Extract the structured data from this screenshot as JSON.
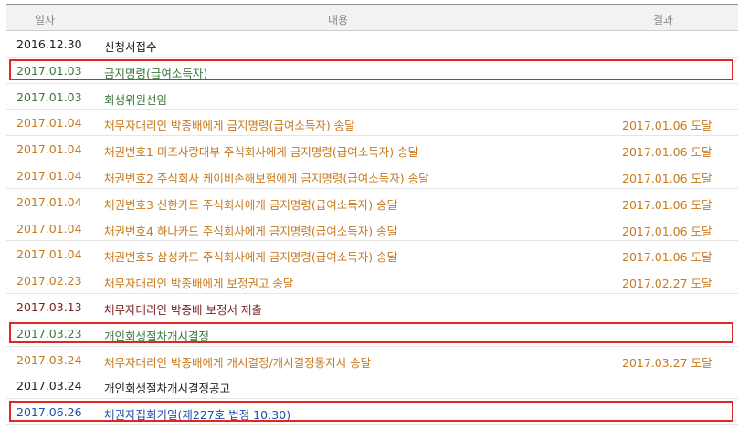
{
  "headers": {
    "date": "일자",
    "content": "내용",
    "result": "결과"
  },
  "colors": {
    "black": "#222222",
    "green": "#3d7a3d",
    "orange": "#c87a1e",
    "maroon": "#7a1f1f",
    "blue": "#1f4fa8",
    "highlight": "#e0271f"
  },
  "rows": [
    {
      "date": "2016.12.30",
      "content": "신청서접수",
      "result": "",
      "color": "black",
      "highlighted": false
    },
    {
      "date": "2017.01.03",
      "content": "금지명령(급여소득자)",
      "result": "",
      "color": "green",
      "highlighted": true
    },
    {
      "date": "2017.01.03",
      "content": "회생위원선임",
      "result": "",
      "color": "green",
      "highlighted": false
    },
    {
      "date": "2017.01.04",
      "content": "채무자대리인 박종배에게 금지명령(급여소득자) 송달",
      "result": "2017.01.06 도달",
      "color": "orange",
      "highlighted": false
    },
    {
      "date": "2017.01.04",
      "content": "채권번호1 미즈사랑대부 주식회사에게 금지명령(급여소득자) 송달",
      "result": "2017.01.06 도달",
      "color": "orange",
      "highlighted": false
    },
    {
      "date": "2017.01.04",
      "content": "채권번호2 주식회사 케이비손해보험에게 금지명령(급여소득자) 송달",
      "result": "2017.01.06 도달",
      "color": "orange",
      "highlighted": false
    },
    {
      "date": "2017.01.04",
      "content": "채권번호3 신한카드 주식회사에게 금지명령(급여소득자) 송달",
      "result": "2017.01.06 도달",
      "color": "orange",
      "highlighted": false
    },
    {
      "date": "2017.01.04",
      "content": "채권번호4 하나카드 주식회사에게 금지명령(급여소득자) 송달",
      "result": "2017.01.06 도달",
      "color": "orange",
      "highlighted": false
    },
    {
      "date": "2017.01.04",
      "content": "채권번호5 삼성카드 주식회사에게 금지명령(급여소득자) 송달",
      "result": "2017.01.06 도달",
      "color": "orange",
      "highlighted": false
    },
    {
      "date": "2017.02.23",
      "content": "채무자대리인 박종배에게 보정권고 송달",
      "result": "2017.02.27 도달",
      "color": "orange",
      "highlighted": false
    },
    {
      "date": "2017.03.13",
      "content": "채무자대리인 박종배 보정서 제출",
      "result": "",
      "color": "maroon",
      "highlighted": false
    },
    {
      "date": "2017.03.23",
      "content": "개인회생절차개시결정",
      "result": "",
      "color": "green",
      "highlighted": true
    },
    {
      "date": "2017.03.24",
      "content": "채무자대리인 박종배에게 개시결정/개시결정통지서 송달",
      "result": "2017.03.27 도달",
      "color": "orange",
      "highlighted": false
    },
    {
      "date": "2017.03.24",
      "content": "개인회생절차개시결정공고",
      "result": "",
      "color": "black",
      "highlighted": false
    },
    {
      "date": "2017.06.26",
      "content": "채권자집회기일(제227호 법정 10:30)",
      "result": "",
      "color": "blue",
      "highlighted": true
    }
  ]
}
